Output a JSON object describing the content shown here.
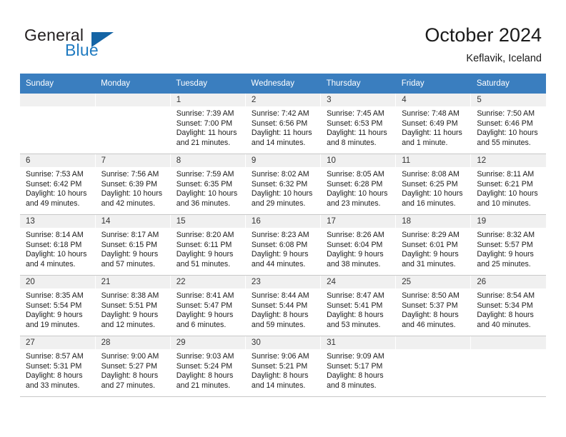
{
  "logo": {
    "line1": "General",
    "line2": "Blue",
    "triangle_color": "#1464a5",
    "blue_color": "#1f7ac0"
  },
  "header": {
    "title": "October 2024",
    "subtitle": "Keflavik, Iceland"
  },
  "theme": {
    "header_row_bg": "#3a7ebf",
    "daynum_band_bg": "#f0f0f0",
    "grid_line": "#c8c8c8"
  },
  "calendar": {
    "weekday_headers": [
      "Sunday",
      "Monday",
      "Tuesday",
      "Wednesday",
      "Thursday",
      "Friday",
      "Saturday"
    ],
    "labels": {
      "sunrise": "Sunrise:",
      "sunset": "Sunset:",
      "daylight": "Daylight:"
    },
    "weeks": [
      [
        {
          "day": "",
          "empty": true
        },
        {
          "day": "",
          "empty": true
        },
        {
          "day": "1",
          "sunrise": "Sunrise: 7:39 AM",
          "sunset": "Sunset: 7:00 PM",
          "daylight_1": "Daylight: 11 hours",
          "daylight_2": "and 21 minutes."
        },
        {
          "day": "2",
          "sunrise": "Sunrise: 7:42 AM",
          "sunset": "Sunset: 6:56 PM",
          "daylight_1": "Daylight: 11 hours",
          "daylight_2": "and 14 minutes."
        },
        {
          "day": "3",
          "sunrise": "Sunrise: 7:45 AM",
          "sunset": "Sunset: 6:53 PM",
          "daylight_1": "Daylight: 11 hours",
          "daylight_2": "and 8 minutes."
        },
        {
          "day": "4",
          "sunrise": "Sunrise: 7:48 AM",
          "sunset": "Sunset: 6:49 PM",
          "daylight_1": "Daylight: 11 hours",
          "daylight_2": "and 1 minute."
        },
        {
          "day": "5",
          "sunrise": "Sunrise: 7:50 AM",
          "sunset": "Sunset: 6:46 PM",
          "daylight_1": "Daylight: 10 hours",
          "daylight_2": "and 55 minutes."
        }
      ],
      [
        {
          "day": "6",
          "sunrise": "Sunrise: 7:53 AM",
          "sunset": "Sunset: 6:42 PM",
          "daylight_1": "Daylight: 10 hours",
          "daylight_2": "and 49 minutes."
        },
        {
          "day": "7",
          "sunrise": "Sunrise: 7:56 AM",
          "sunset": "Sunset: 6:39 PM",
          "daylight_1": "Daylight: 10 hours",
          "daylight_2": "and 42 minutes."
        },
        {
          "day": "8",
          "sunrise": "Sunrise: 7:59 AM",
          "sunset": "Sunset: 6:35 PM",
          "daylight_1": "Daylight: 10 hours",
          "daylight_2": "and 36 minutes."
        },
        {
          "day": "9",
          "sunrise": "Sunrise: 8:02 AM",
          "sunset": "Sunset: 6:32 PM",
          "daylight_1": "Daylight: 10 hours",
          "daylight_2": "and 29 minutes."
        },
        {
          "day": "10",
          "sunrise": "Sunrise: 8:05 AM",
          "sunset": "Sunset: 6:28 PM",
          "daylight_1": "Daylight: 10 hours",
          "daylight_2": "and 23 minutes."
        },
        {
          "day": "11",
          "sunrise": "Sunrise: 8:08 AM",
          "sunset": "Sunset: 6:25 PM",
          "daylight_1": "Daylight: 10 hours",
          "daylight_2": "and 16 minutes."
        },
        {
          "day": "12",
          "sunrise": "Sunrise: 8:11 AM",
          "sunset": "Sunset: 6:21 PM",
          "daylight_1": "Daylight: 10 hours",
          "daylight_2": "and 10 minutes."
        }
      ],
      [
        {
          "day": "13",
          "sunrise": "Sunrise: 8:14 AM",
          "sunset": "Sunset: 6:18 PM",
          "daylight_1": "Daylight: 10 hours",
          "daylight_2": "and 4 minutes."
        },
        {
          "day": "14",
          "sunrise": "Sunrise: 8:17 AM",
          "sunset": "Sunset: 6:15 PM",
          "daylight_1": "Daylight: 9 hours",
          "daylight_2": "and 57 minutes."
        },
        {
          "day": "15",
          "sunrise": "Sunrise: 8:20 AM",
          "sunset": "Sunset: 6:11 PM",
          "daylight_1": "Daylight: 9 hours",
          "daylight_2": "and 51 minutes."
        },
        {
          "day": "16",
          "sunrise": "Sunrise: 8:23 AM",
          "sunset": "Sunset: 6:08 PM",
          "daylight_1": "Daylight: 9 hours",
          "daylight_2": "and 44 minutes."
        },
        {
          "day": "17",
          "sunrise": "Sunrise: 8:26 AM",
          "sunset": "Sunset: 6:04 PM",
          "daylight_1": "Daylight: 9 hours",
          "daylight_2": "and 38 minutes."
        },
        {
          "day": "18",
          "sunrise": "Sunrise: 8:29 AM",
          "sunset": "Sunset: 6:01 PM",
          "daylight_1": "Daylight: 9 hours",
          "daylight_2": "and 31 minutes."
        },
        {
          "day": "19",
          "sunrise": "Sunrise: 8:32 AM",
          "sunset": "Sunset: 5:57 PM",
          "daylight_1": "Daylight: 9 hours",
          "daylight_2": "and 25 minutes."
        }
      ],
      [
        {
          "day": "20",
          "sunrise": "Sunrise: 8:35 AM",
          "sunset": "Sunset: 5:54 PM",
          "daylight_1": "Daylight: 9 hours",
          "daylight_2": "and 19 minutes."
        },
        {
          "day": "21",
          "sunrise": "Sunrise: 8:38 AM",
          "sunset": "Sunset: 5:51 PM",
          "daylight_1": "Daylight: 9 hours",
          "daylight_2": "and 12 minutes."
        },
        {
          "day": "22",
          "sunrise": "Sunrise: 8:41 AM",
          "sunset": "Sunset: 5:47 PM",
          "daylight_1": "Daylight: 9 hours",
          "daylight_2": "and 6 minutes."
        },
        {
          "day": "23",
          "sunrise": "Sunrise: 8:44 AM",
          "sunset": "Sunset: 5:44 PM",
          "daylight_1": "Daylight: 8 hours",
          "daylight_2": "and 59 minutes."
        },
        {
          "day": "24",
          "sunrise": "Sunrise: 8:47 AM",
          "sunset": "Sunset: 5:41 PM",
          "daylight_1": "Daylight: 8 hours",
          "daylight_2": "and 53 minutes."
        },
        {
          "day": "25",
          "sunrise": "Sunrise: 8:50 AM",
          "sunset": "Sunset: 5:37 PM",
          "daylight_1": "Daylight: 8 hours",
          "daylight_2": "and 46 minutes."
        },
        {
          "day": "26",
          "sunrise": "Sunrise: 8:54 AM",
          "sunset": "Sunset: 5:34 PM",
          "daylight_1": "Daylight: 8 hours",
          "daylight_2": "and 40 minutes."
        }
      ],
      [
        {
          "day": "27",
          "sunrise": "Sunrise: 8:57 AM",
          "sunset": "Sunset: 5:31 PM",
          "daylight_1": "Daylight: 8 hours",
          "daylight_2": "and 33 minutes."
        },
        {
          "day": "28",
          "sunrise": "Sunrise: 9:00 AM",
          "sunset": "Sunset: 5:27 PM",
          "daylight_1": "Daylight: 8 hours",
          "daylight_2": "and 27 minutes."
        },
        {
          "day": "29",
          "sunrise": "Sunrise: 9:03 AM",
          "sunset": "Sunset: 5:24 PM",
          "daylight_1": "Daylight: 8 hours",
          "daylight_2": "and 21 minutes."
        },
        {
          "day": "30",
          "sunrise": "Sunrise: 9:06 AM",
          "sunset": "Sunset: 5:21 PM",
          "daylight_1": "Daylight: 8 hours",
          "daylight_2": "and 14 minutes."
        },
        {
          "day": "31",
          "sunrise": "Sunrise: 9:09 AM",
          "sunset": "Sunset: 5:17 PM",
          "daylight_1": "Daylight: 8 hours",
          "daylight_2": "and 8 minutes."
        },
        {
          "day": "",
          "empty": true
        },
        {
          "day": "",
          "empty": true
        }
      ]
    ]
  }
}
